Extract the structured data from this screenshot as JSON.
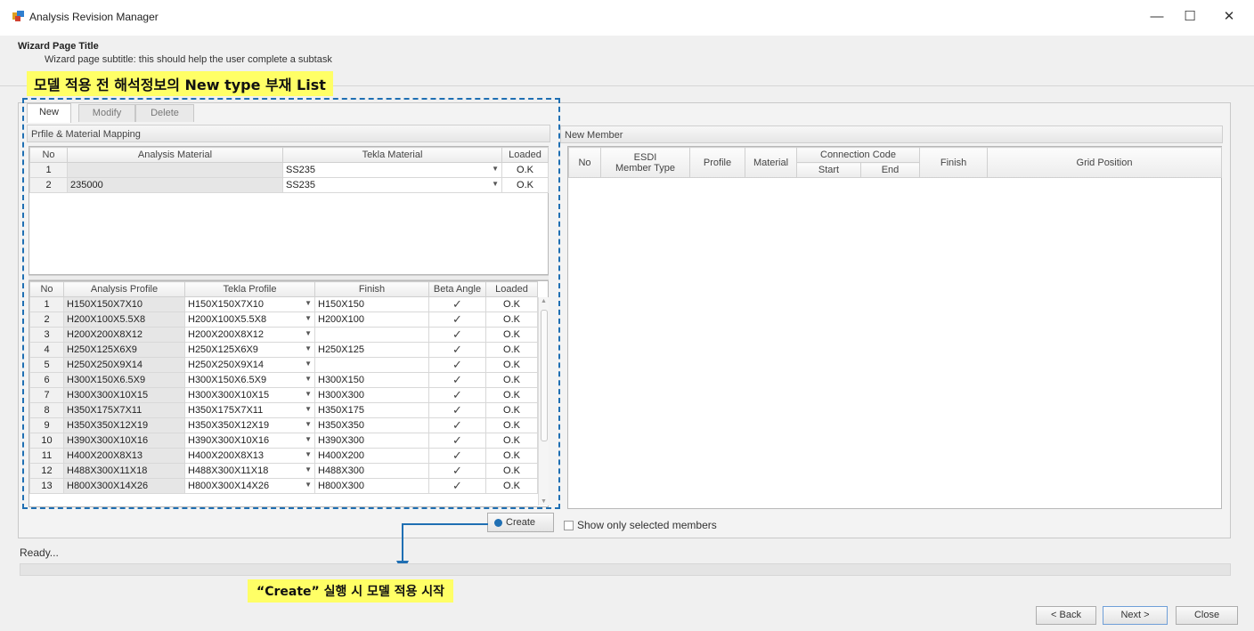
{
  "window": {
    "title": "Analysis Revision Manager",
    "controls": {
      "minimize": "—",
      "maximize": "☐",
      "close": "✕"
    }
  },
  "wizard": {
    "title": "Wizard Page Title",
    "subtitle": "Wizard page subtitle: this should help the user complete a subtask"
  },
  "annotations": {
    "top_callout": "모델 적용 전 해석정보의 New type 부재 List",
    "bottom_callout_quote": "“Create”",
    "bottom_callout_rest": " 실행 시 모델 적용 시작",
    "highlight_color": "#ffff66",
    "accent_color": "#1f6fb3"
  },
  "tabs": [
    {
      "label": "New",
      "active": true
    },
    {
      "label": "Modify",
      "active": false
    },
    {
      "label": "Delete",
      "active": false
    }
  ],
  "material_section": {
    "caption": "Prfile & Material Mapping",
    "headers": [
      "No",
      "Analysis Material",
      "Tekla Material",
      "Loaded"
    ],
    "rows": [
      {
        "no": "1",
        "analysis": "",
        "tekla": "SS235",
        "loaded": "O.K"
      },
      {
        "no": "2",
        "analysis": "235000",
        "tekla": "SS235",
        "loaded": "O.K"
      }
    ]
  },
  "profile_section": {
    "headers": [
      "No",
      "Analysis Profile",
      "Tekla Profile",
      "Finish",
      "Beta Angle",
      "Loaded"
    ],
    "rows": [
      {
        "no": "1",
        "analysis": "H150X150X7X10",
        "tekla": "H150X150X7X10",
        "finish": "H150X150",
        "beta": true,
        "loaded": "O.K"
      },
      {
        "no": "2",
        "analysis": "H200X100X5.5X8",
        "tekla": "H200X100X5.5X8",
        "finish": "H200X100",
        "beta": true,
        "loaded": "O.K"
      },
      {
        "no": "3",
        "analysis": "H200X200X8X12",
        "tekla": "H200X200X8X12",
        "finish": "",
        "beta": true,
        "loaded": "O.K"
      },
      {
        "no": "4",
        "analysis": "H250X125X6X9",
        "tekla": "H250X125X6X9",
        "finish": "H250X125",
        "beta": true,
        "loaded": "O.K"
      },
      {
        "no": "5",
        "analysis": "H250X250X9X14",
        "tekla": "H250X250X9X14",
        "finish": "",
        "beta": true,
        "loaded": "O.K"
      },
      {
        "no": "6",
        "analysis": "H300X150X6.5X9",
        "tekla": "H300X150X6.5X9",
        "finish": "H300X150",
        "beta": true,
        "loaded": "O.K"
      },
      {
        "no": "7",
        "analysis": "H300X300X10X15",
        "tekla": "H300X300X10X15",
        "finish": "H300X300",
        "beta": true,
        "loaded": "O.K"
      },
      {
        "no": "8",
        "analysis": "H350X175X7X11",
        "tekla": "H350X175X7X11",
        "finish": "H350X175",
        "beta": true,
        "loaded": "O.K"
      },
      {
        "no": "9",
        "analysis": "H350X350X12X19",
        "tekla": "H350X350X12X19",
        "finish": "H350X350",
        "beta": true,
        "loaded": "O.K"
      },
      {
        "no": "10",
        "analysis": "H390X300X10X16",
        "tekla": "H390X300X10X16",
        "finish": "H390X300",
        "beta": true,
        "loaded": "O.K"
      },
      {
        "no": "11",
        "analysis": "H400X200X8X13",
        "tekla": "H400X200X8X13",
        "finish": "H400X200",
        "beta": true,
        "loaded": "O.K"
      },
      {
        "no": "12",
        "analysis": "H488X300X11X18",
        "tekla": "H488X300X11X18",
        "finish": "H488X300",
        "beta": true,
        "loaded": "O.K"
      },
      {
        "no": "13",
        "analysis": "H800X300X14X26",
        "tekla": "H800X300X14X26",
        "finish": "H800X300",
        "beta": true,
        "loaded": "O.K"
      }
    ]
  },
  "new_member": {
    "caption": "New Member",
    "headers": {
      "no": "No",
      "esdi": "ESDI\nMember Type",
      "profile": "Profile",
      "material": "Material",
      "connection": "Connection Code",
      "start": "Start",
      "end": "End",
      "finish": "Finish",
      "grid": "Grid Position"
    },
    "show_selected_label": "Show only selected members"
  },
  "create_label": "Create",
  "status_text": "Ready...",
  "buttons": {
    "back": "< Back",
    "next": "Next >",
    "close": "Close"
  }
}
